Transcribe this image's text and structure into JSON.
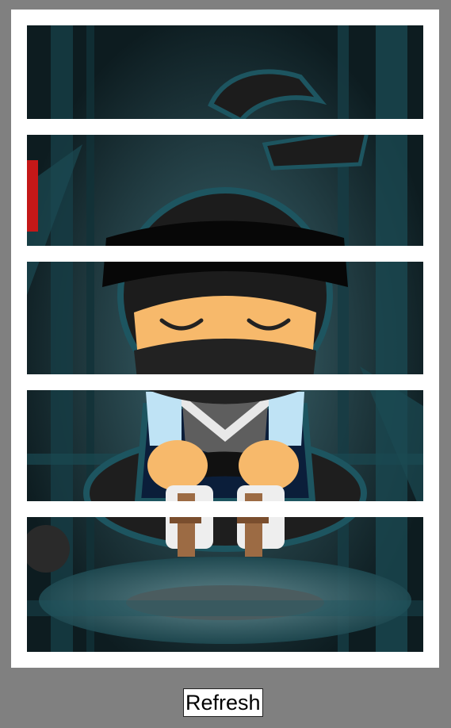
{
  "puzzle": {
    "piece_count": 5,
    "scene": "meditating-ninja"
  },
  "controls": {
    "refresh_label": "Refresh"
  },
  "colors": {
    "page_background": "#808080",
    "frame": "#ffffff",
    "scene_dark": "#0f2328",
    "scene_teal": "#1d5560"
  }
}
